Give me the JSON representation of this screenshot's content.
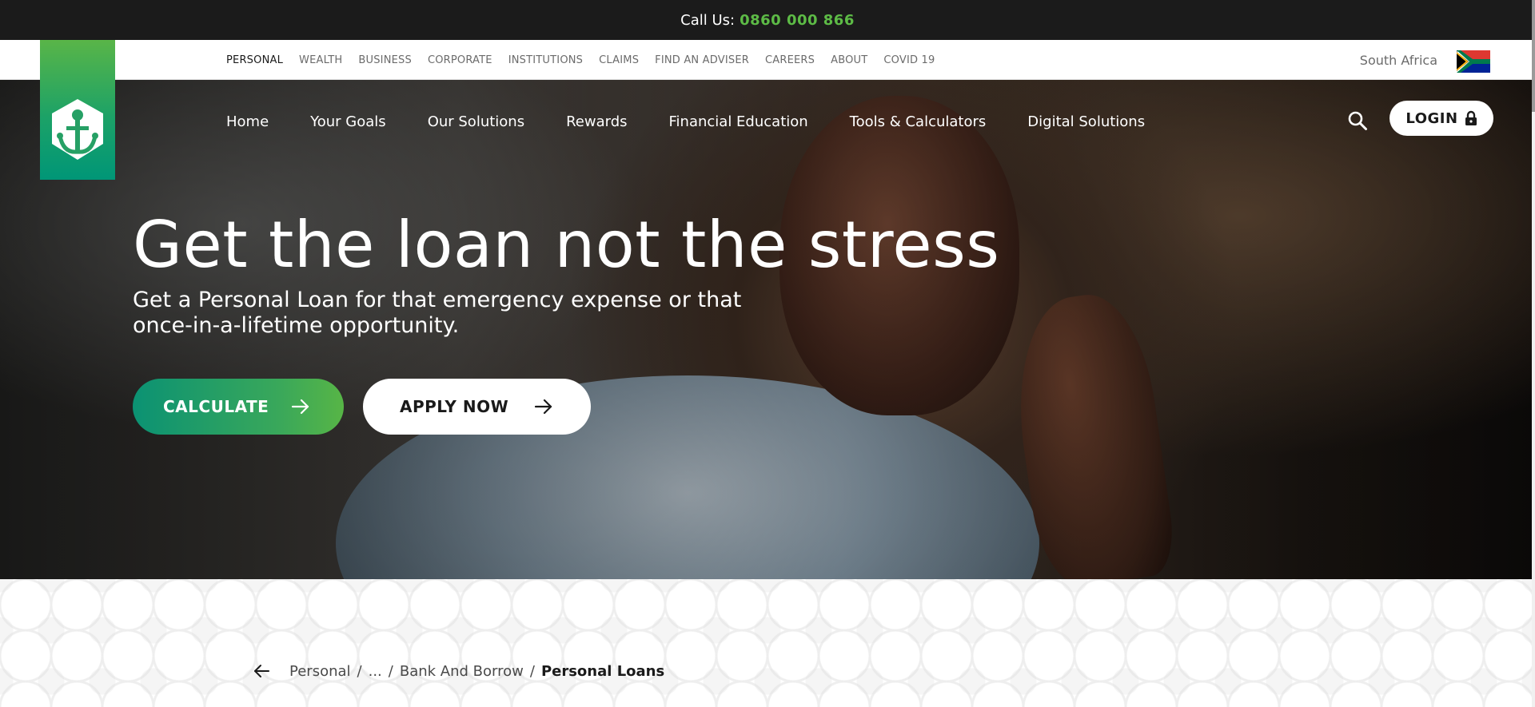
{
  "topbar": {
    "label": "Call Us:",
    "phone": "0860 000 866"
  },
  "utility_nav": {
    "links": [
      "PERSONAL",
      "WEALTH",
      "BUSINESS",
      "CORPORATE",
      "INSTITUTIONS",
      "CLAIMS",
      "FIND AN ADVISER",
      "CAREERS",
      "ABOUT",
      "COVID 19"
    ],
    "active": "PERSONAL",
    "region": "South Africa"
  },
  "main_nav": {
    "items": [
      "Home",
      "Your Goals",
      "Our Solutions",
      "Rewards",
      "Financial Education",
      "Tools & Calculators",
      "Digital Solutions"
    ],
    "login_label": "LOGIN"
  },
  "hero": {
    "title": "Get the loan not the stress",
    "subtitle": "Get a Personal Loan for that emergency expense or that once-in-a-lifetime opportunity.",
    "calculate_label": "CALCULATE",
    "apply_label": "APPLY NOW"
  },
  "breadcrumb": {
    "items": [
      "Personal",
      "...",
      "Bank And Borrow"
    ],
    "current": "Personal Loans"
  },
  "colors": {
    "brand_green": "#5dbb46",
    "brand_teal": "#009677",
    "topbar": "#1b1b1b"
  }
}
